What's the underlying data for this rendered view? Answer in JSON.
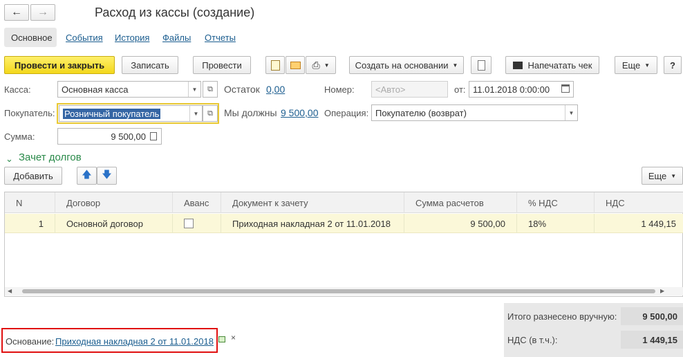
{
  "window": {
    "title": "Расход из кассы (создание)"
  },
  "tabs": [
    "Основное",
    "События",
    "История",
    "Файлы",
    "Отчеты"
  ],
  "toolbar": {
    "post_close": "Провести и закрыть",
    "save": "Записать",
    "post": "Провести",
    "create_based": "Создать на основании",
    "print_receipt": "Напечатать чек",
    "more": "Еще",
    "help": "?"
  },
  "form": {
    "kassa_label": "Касса:",
    "kassa_value": "Основная касса",
    "balance_label": "Остаток",
    "balance_value": "0,00",
    "number_label": "Номер:",
    "number_placeholder": "<Авто>",
    "date_label": "от:",
    "date_value": "11.01.2018  0:00:00",
    "buyer_label": "Покупатель:",
    "buyer_value": "Розничный покупатель",
    "we_owe_label": "Мы должны",
    "we_owe_value": "9 500,00",
    "operation_label": "Операция:",
    "operation_value": "Покупателю (возврат)",
    "sum_label": "Сумма:",
    "sum_value": "9 500,00"
  },
  "debts": {
    "section_title": "Зачет долгов",
    "add": "Добавить",
    "more": "Еще"
  },
  "table": {
    "headers": [
      "N",
      "Договор",
      "Аванс",
      "Документ к зачету",
      "Сумма расчетов",
      "% НДС",
      "НДС"
    ],
    "rows": [
      {
        "n": "1",
        "contract": "Основной договор",
        "advance": false,
        "document": "Приходная накладная 2 от 11.01.2018",
        "amount": "9 500,00",
        "vat_rate": "18%",
        "vat": "1 449,15"
      }
    ]
  },
  "totals": {
    "manual_label": "Итого разнесено вручную:",
    "manual_value": "9 500,00",
    "vat_label": "НДС (в т.ч.):",
    "vat_value": "1 449,15"
  },
  "basis": {
    "label": "Основание:",
    "link": "Приходная накладная 2 от 11.01.2018",
    "clear": "×"
  }
}
